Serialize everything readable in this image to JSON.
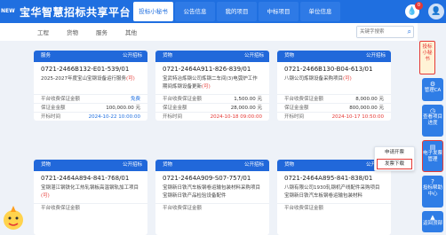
{
  "header": {
    "logo_text": "NEW",
    "title": "宝华智慧招标共享平台",
    "nav": [
      "投标小秘书",
      "公告信息",
      "我的项目",
      "中标项目",
      "单位信息"
    ],
    "active_nav": 0,
    "notification_count": "0"
  },
  "subnav": {
    "tabs": [
      "工程",
      "货物",
      "服务",
      "其他"
    ],
    "search_placeholder": "关键字搜索"
  },
  "cards": [
    {
      "tag": "服务",
      "public": "公开招标",
      "no": "0721-2466B132-E01-539/01",
      "desc": "2025-2027年度宝山宝钢设备运行服务",
      "desc_tag": "(可)",
      "rows": [
        [
          "平台收费保证金额",
          "免费"
        ],
        [
          "保证金金额",
          "100,000.00 元"
        ],
        [
          "开标时间",
          "2024-10-22 10:00:00"
        ]
      ]
    },
    {
      "tag": "货物",
      "public": "公开招标",
      "no": "0721-2464A911-826-839/01",
      "desc": "宝武特冶炼钢公司炼钢二车间(3)电弧炉工作期间炼钢设备更新",
      "desc_tag": "(可)",
      "rows": [
        [
          "平台收费保证金额",
          "1,500.00 元"
        ],
        [
          "保证金金额",
          "28,000.00 元"
        ],
        [
          "开标时间",
          "2024-10-18 09:00:00"
        ]
      ]
    },
    {
      "tag": "货物",
      "public": "公开招标",
      "no": "0721-2466B130-B04-613/01",
      "desc": "八钢公司炼钢设备采购项目",
      "desc_tag": "(可)",
      "rows": [
        [
          "平台收费保证金额",
          "8,000.00 元"
        ],
        [
          "保证金金额",
          "800,000.00 元"
        ],
        [
          "开标时间",
          "2024-10-17 10:50:00"
        ]
      ]
    },
    {
      "tag": "货物",
      "public": "公开招标",
      "no": "0721-2464A894-841-768/01",
      "desc": "宝钢湛江钢铁化工热轧钢板高温钢轨加工项目",
      "desc_tag": "(可)",
      "rows": [
        [
          "平台收费保证金额",
          ""
        ]
      ]
    },
    {
      "tag": "货物",
      "public": "公开招标",
      "no": "0721-2464A909-S07-757/01",
      "desc": "宝钢新日铁汽车板钢卷运输包装材料采购项目宝钢新日铁产品检验设备配件",
      "desc_tag": "",
      "rows": [
        [
          "平台收费保证金额",
          ""
        ]
      ]
    },
    {
      "tag": "货物",
      "public": "公开招标",
      "no": "0721-2464A895-841-838/01",
      "desc": "八钢有限公司1930轧钢机产线配件采购项目宝钢新日铁汽车板钢卷运输包装材料",
      "desc_tag": "",
      "rows": [
        [
          "平台收费保证金额",
          ""
        ]
      ]
    }
  ],
  "sidebar": {
    "secretary_label": "投标小秘书",
    "buttons": [
      "管理CA",
      "查看项目进度",
      "电子发票管理",
      "投标帮助中心",
      "返回顶部"
    ],
    "highlighted_index": 2
  },
  "popup": {
    "items": [
      "申请开票",
      "发票下载"
    ],
    "selected_index": 1
  },
  "colors": {
    "primary": "#1f6fe0",
    "card_header": "#2168da",
    "highlight": "#e53935"
  }
}
